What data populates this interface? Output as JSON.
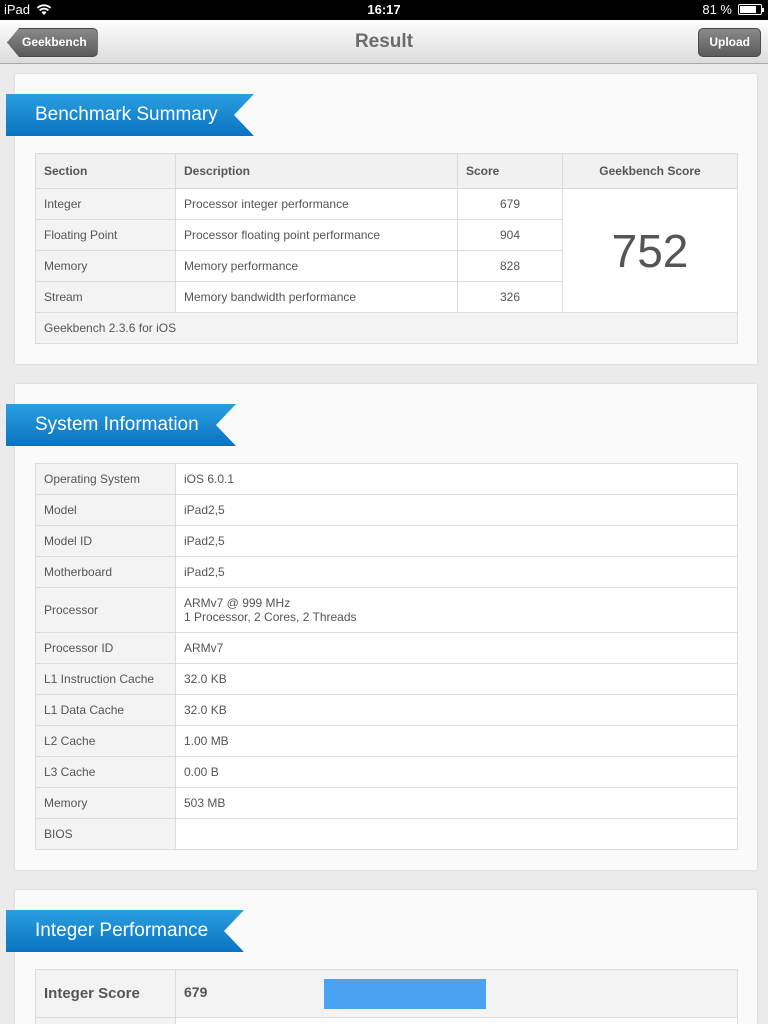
{
  "status_bar": {
    "carrier": "iPad",
    "time": "16:17",
    "battery": "81 %",
    "battery_level": 0.81
  },
  "nav": {
    "back_label": "Geekbench",
    "title": "Result",
    "upload_label": "Upload"
  },
  "benchmark_summary": {
    "title": "Benchmark Summary",
    "headers": {
      "section": "Section",
      "description": "Description",
      "score": "Score",
      "gb_score": "Geekbench Score"
    },
    "rows": [
      {
        "section": "Integer",
        "description": "Processor integer performance",
        "score": "679"
      },
      {
        "section": "Floating Point",
        "description": "Processor floating point performance",
        "score": "904"
      },
      {
        "section": "Memory",
        "description": "Memory performance",
        "score": "828"
      },
      {
        "section": "Stream",
        "description": "Memory bandwidth performance",
        "score": "326"
      }
    ],
    "geekbench_score": "752",
    "footer": "Geekbench 2.3.6 for iOS"
  },
  "system_information": {
    "title": "System Information",
    "rows": [
      {
        "label": "Operating System",
        "value": "iOS 6.0.1"
      },
      {
        "label": "Model",
        "value": "iPad2,5"
      },
      {
        "label": "Model ID",
        "value": "iPad2,5"
      },
      {
        "label": "Motherboard",
        "value": "iPad2,5"
      },
      {
        "label": "Processor",
        "value": "ARMv7 @ 999 MHz",
        "value2": "1 Processor, 2 Cores, 2 Threads"
      },
      {
        "label": "Processor ID",
        "value": "ARMv7"
      },
      {
        "label": "L1 Instruction Cache",
        "value": "32.0 KB"
      },
      {
        "label": "L1 Data Cache",
        "value": "32.0 KB"
      },
      {
        "label": "L2 Cache",
        "value": "1.00 MB"
      },
      {
        "label": "L3 Cache",
        "value": "0.00 B"
      },
      {
        "label": "Memory",
        "value": "503 MB"
      },
      {
        "label": "BIOS",
        "value": ""
      }
    ]
  },
  "integer_performance": {
    "title": "Integer Performance",
    "score_label": "Integer Score",
    "score": "679",
    "bar_fraction": 0.679
  },
  "colors": {
    "accent": "#1a8ad4",
    "bar": "#4aa3f2"
  }
}
